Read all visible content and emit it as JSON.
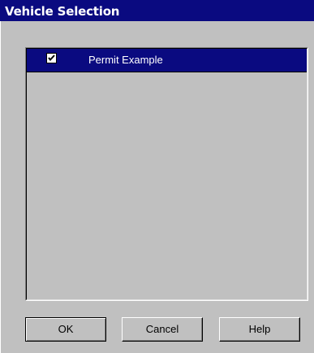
{
  "window": {
    "title": "Vehicle Selection"
  },
  "vehicle_list": {
    "items": [
      {
        "label": "Permit Example",
        "checked": true,
        "selected": true
      }
    ]
  },
  "buttons": {
    "ok_label": "OK",
    "cancel_label": "Cancel",
    "help_label": "Help"
  },
  "colors": {
    "title_bar": "#0a0a80",
    "selection": "#0a0a80",
    "face": "#c0c0c0"
  }
}
